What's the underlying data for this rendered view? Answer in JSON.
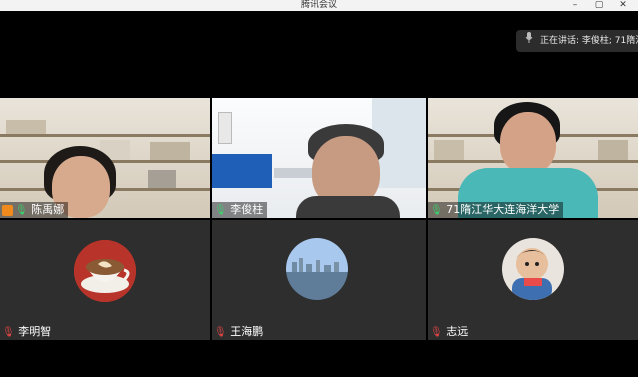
{
  "window": {
    "title": "腾讯会议"
  },
  "speaking_indicator": {
    "text": "正在讲话: 李俊柱; 71隋江..."
  },
  "participants": [
    {
      "name": "陈禹娜",
      "mic": "on",
      "host": true,
      "video": true
    },
    {
      "name": "李俊柱",
      "mic": "on",
      "host": false,
      "video": true
    },
    {
      "name": "71隋江华大连海洋大学",
      "mic": "on",
      "host": false,
      "video": true
    },
    {
      "name": "李明智",
      "mic": "muted",
      "host": false,
      "video": false,
      "avatar": "coffee-cup"
    },
    {
      "name": "王海鹏",
      "mic": "muted",
      "host": false,
      "video": false,
      "avatar": "city-skyline"
    },
    {
      "name": "志远",
      "mic": "muted",
      "host": false,
      "video": false,
      "avatar": "child-photo"
    }
  ],
  "colors": {
    "mic_on": "#3ad06b",
    "mic_muted": "#e24646",
    "host_badge": "#f08a1c",
    "tile_bg": "#2e2e2e"
  }
}
